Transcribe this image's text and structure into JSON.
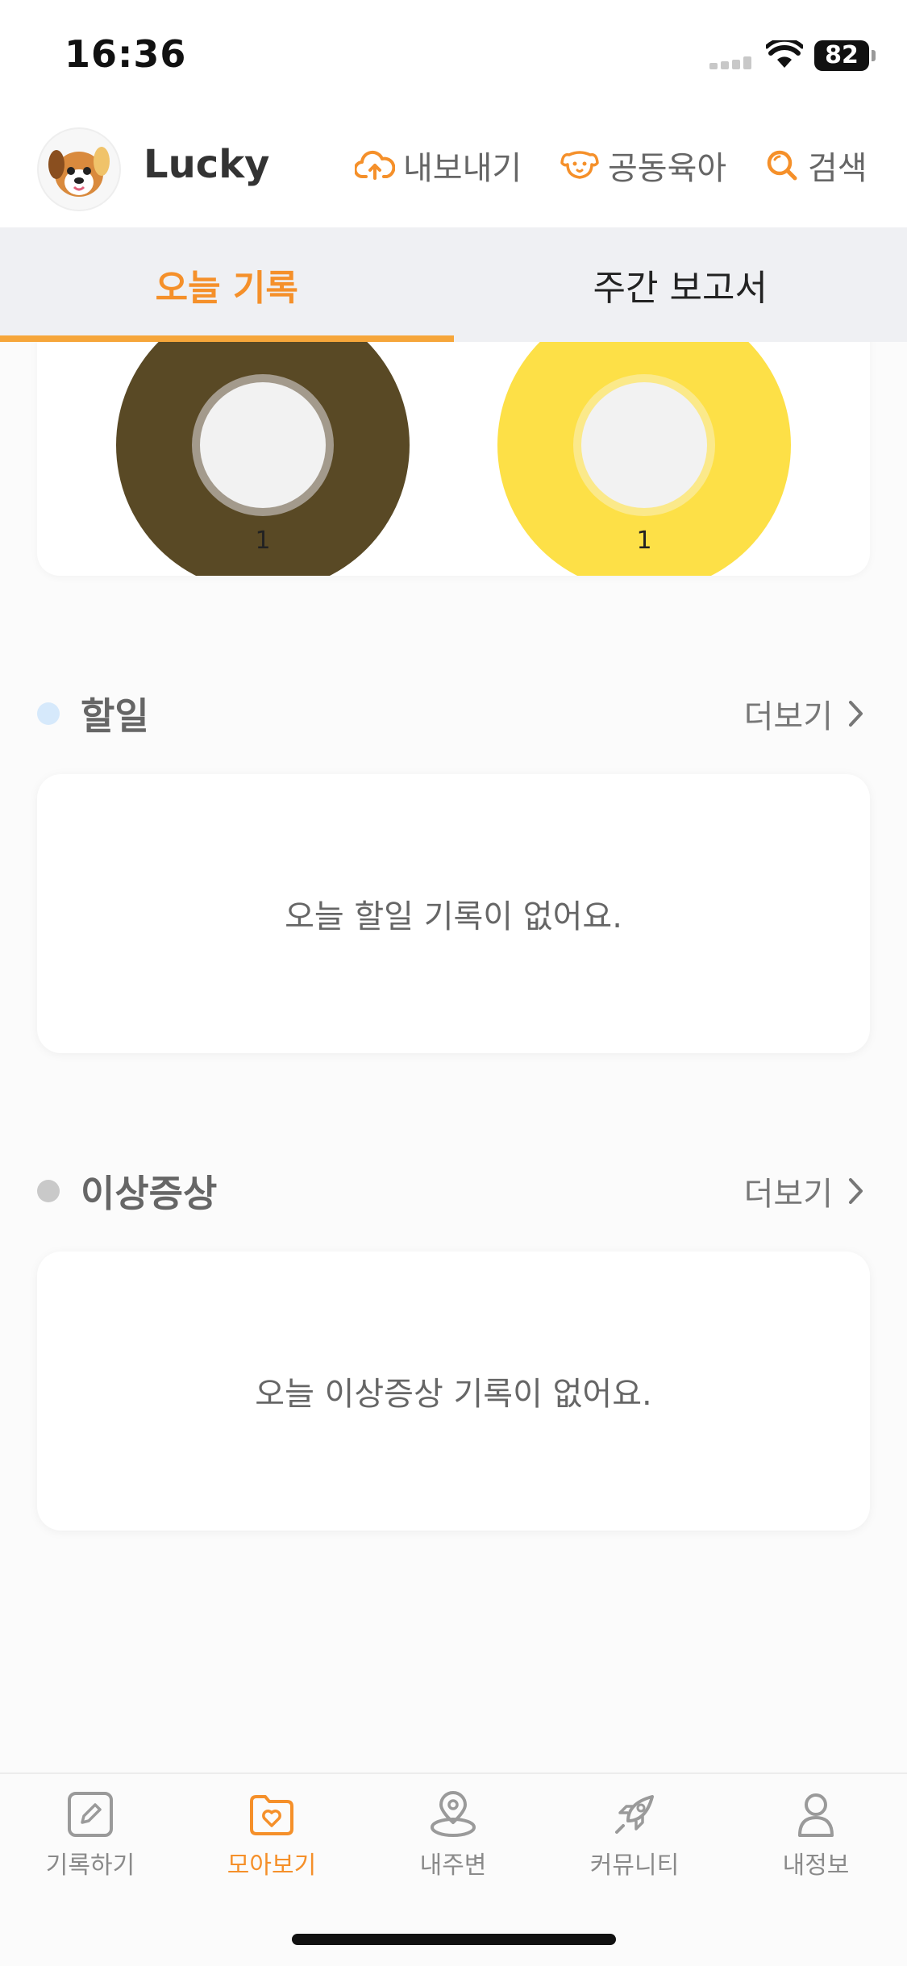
{
  "status_bar": {
    "time": "16:36",
    "battery": "82"
  },
  "header": {
    "pet_name": "Lucky",
    "export_label": "내보내기",
    "co_parenting_label": "공동육아",
    "search_label": "검색"
  },
  "tabs": [
    {
      "label": "오늘 기록",
      "active": true
    },
    {
      "label": "주간 보고서",
      "active": false
    }
  ],
  "chart_data": [
    {
      "type": "pie",
      "categories": [
        "1"
      ],
      "values": [
        1
      ],
      "colors": [
        "#594925"
      ]
    },
    {
      "type": "pie",
      "categories": [
        "1"
      ],
      "values": [
        1
      ],
      "colors": [
        "#fde047"
      ]
    }
  ],
  "sections": {
    "todo": {
      "title": "할일",
      "more": "더보기",
      "empty": "오늘 할일 기록이 없어요.",
      "dot_color": "#d6e9fb"
    },
    "symptom": {
      "title": "이상증상",
      "more": "더보기",
      "empty": "오늘 이상증상 기록이 없어요.",
      "dot_color": "#c9c9c9"
    }
  },
  "bottom_nav": [
    {
      "label": "기록하기",
      "icon": "pencil-icon",
      "active": false
    },
    {
      "label": "모아보기",
      "icon": "folder-heart-icon",
      "active": true
    },
    {
      "label": "내주변",
      "icon": "location-icon",
      "active": false
    },
    {
      "label": "커뮤니티",
      "icon": "rocket-icon",
      "active": false
    },
    {
      "label": "내정보",
      "icon": "person-icon",
      "active": false
    }
  ],
  "colors": {
    "accent": "#f5902a",
    "tab_underline": "#f6a63a"
  }
}
